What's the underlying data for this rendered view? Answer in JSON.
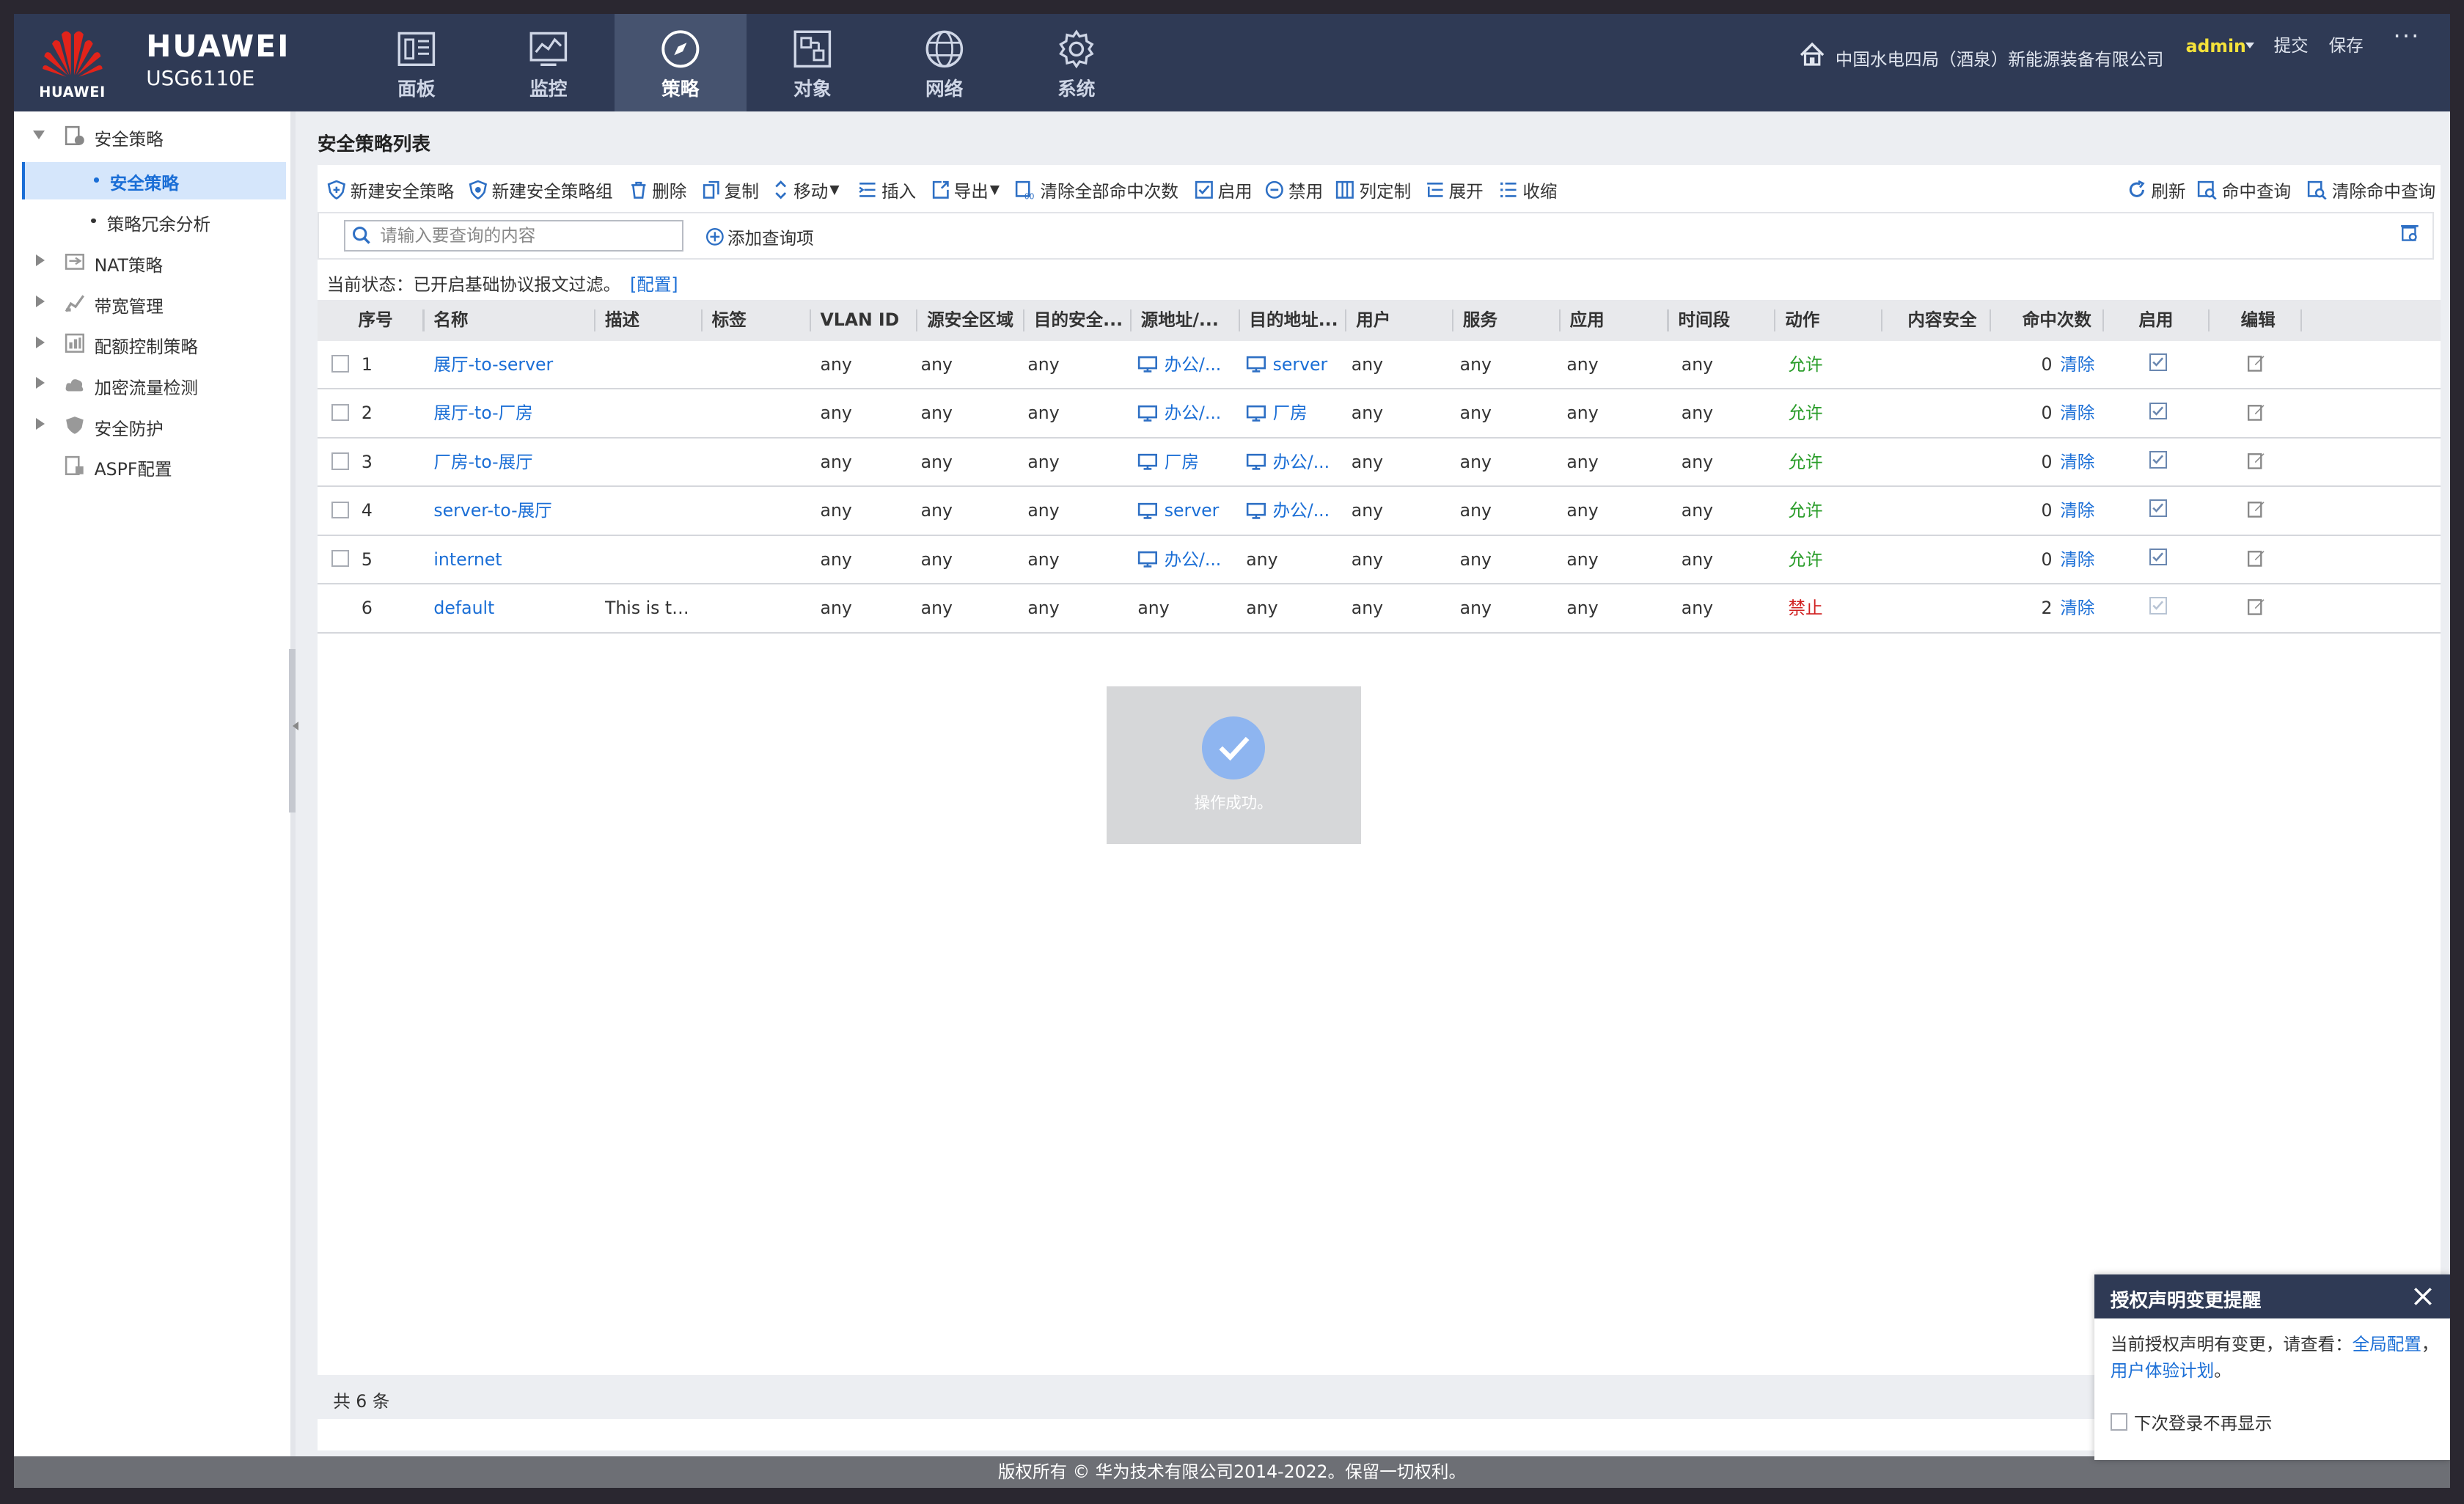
{
  "brand": {
    "logo_text": "HUAWEI",
    "name": "HUAWEI",
    "model": "USG6110E"
  },
  "nav": [
    {
      "label": "面板",
      "icon": "dashboard-icon"
    },
    {
      "label": "监控",
      "icon": "monitor-icon"
    },
    {
      "label": "策略",
      "icon": "compass-icon",
      "active": true
    },
    {
      "label": "对象",
      "icon": "object-icon"
    },
    {
      "label": "网络",
      "icon": "globe-icon"
    },
    {
      "label": "系统",
      "icon": "gear-icon"
    }
  ],
  "header": {
    "org": "中国水电四局（酒泉）新能源装备有限公司",
    "user": "admin",
    "commit": "提交",
    "save": "保存",
    "more": "···"
  },
  "sidebar": {
    "items": [
      {
        "label": "安全策略",
        "expanded": true
      },
      {
        "label": "安全策略",
        "sub": true,
        "selected": true
      },
      {
        "label": "策略冗余分析",
        "sub": true
      },
      {
        "label": "NAT策略"
      },
      {
        "label": "带宽管理"
      },
      {
        "label": "配额控制策略"
      },
      {
        "label": "加密流量检测"
      },
      {
        "label": "安全防护"
      },
      {
        "label": "ASPF配置"
      }
    ]
  },
  "page": {
    "title": "安全策略列表"
  },
  "toolbar": {
    "new_policy": "新建安全策略",
    "new_group": "新建安全策略组",
    "delete": "删除",
    "copy": "复制",
    "move": "移动",
    "insert": "插入",
    "export": "导出",
    "clear_hits": "清除全部命中次数",
    "enable": "启用",
    "disable": "禁用",
    "columns": "列定制",
    "expand": "展开",
    "collapse": "收缩",
    "refresh": "刷新",
    "hit_query": "命中查询",
    "clear_hit_query": "清除命中查询"
  },
  "search": {
    "placeholder": "请输入要查询的内容",
    "add_query": "添加查询项"
  },
  "status": {
    "text": "当前状态：已开启基础协议报文过滤。",
    "link": "[配置]"
  },
  "table": {
    "headers": [
      "序号",
      "名称",
      "描述",
      "标签",
      "VLAN ID",
      "源安全区域",
      "目的安全...",
      "源地址/...",
      "目的地址...",
      "用户",
      "服务",
      "应用",
      "时间段",
      "动作",
      "内容安全",
      "命中次数",
      "启用",
      "编辑"
    ],
    "rows": [
      {
        "no": "1",
        "name": "展厅-to-server",
        "desc": "",
        "vlan": "any",
        "src_zone": "any",
        "dst_zone": "any",
        "src": "办公/...",
        "src_icon": true,
        "dst": "server",
        "dst_icon": true,
        "user": "any",
        "service": "any",
        "app": "any",
        "time": "any",
        "action": "允许",
        "hits": "0",
        "clear": "清除"
      },
      {
        "no": "2",
        "name": "展厅-to-厂房",
        "desc": "",
        "vlan": "any",
        "src_zone": "any",
        "dst_zone": "any",
        "src": "办公/...",
        "src_icon": true,
        "dst": "厂房",
        "dst_icon": true,
        "user": "any",
        "service": "any",
        "app": "any",
        "time": "any",
        "action": "允许",
        "hits": "0",
        "clear": "清除"
      },
      {
        "no": "3",
        "name": "厂房-to-展厅",
        "desc": "",
        "vlan": "any",
        "src_zone": "any",
        "dst_zone": "any",
        "src": "厂房",
        "src_icon": true,
        "dst": "办公/...",
        "dst_icon": true,
        "user": "any",
        "service": "any",
        "app": "any",
        "time": "any",
        "action": "允许",
        "hits": "0",
        "clear": "清除"
      },
      {
        "no": "4",
        "name": "server-to-展厅",
        "desc": "",
        "vlan": "any",
        "src_zone": "any",
        "dst_zone": "any",
        "src": "server",
        "src_icon": true,
        "dst": "办公/...",
        "dst_icon": true,
        "user": "any",
        "service": "any",
        "app": "any",
        "time": "any",
        "action": "允许",
        "hits": "0",
        "clear": "清除"
      },
      {
        "no": "5",
        "name": "internet",
        "desc": "",
        "vlan": "any",
        "src_zone": "any",
        "dst_zone": "any",
        "src": "办公/...",
        "src_icon": true,
        "dst": "any",
        "dst_icon": false,
        "user": "any",
        "service": "any",
        "app": "any",
        "time": "any",
        "action": "允许",
        "hits": "0",
        "clear": "清除"
      },
      {
        "no": "6",
        "name": "default",
        "desc": "This is th...",
        "vlan": "any",
        "src_zone": "any",
        "dst_zone": "any",
        "src": "any",
        "src_icon": false,
        "dst": "any",
        "dst_icon": false,
        "user": "any",
        "service": "any",
        "app": "any",
        "time": "any",
        "action": "禁止",
        "hits": "2",
        "clear": "清除"
      }
    ],
    "total": "共 6 条"
  },
  "toast": {
    "message": "操作成功。"
  },
  "copyright": "版权所有 © 华为技术有限公司2014-2022。保留一切权利。",
  "notice": {
    "title": "授权声明变更提醒",
    "body": "当前授权声明有变更，请查看：",
    "link1": "全局配置",
    "sep": "，",
    "link2": "用户体验计划",
    "end": "。",
    "checkbox": "下次登录不再显示"
  },
  "colors": {
    "header": "#2f3a55",
    "link": "#1a6ed6",
    "allow": "#2a9d2a",
    "deny": "#d02020",
    "user": "#f5e23a"
  }
}
